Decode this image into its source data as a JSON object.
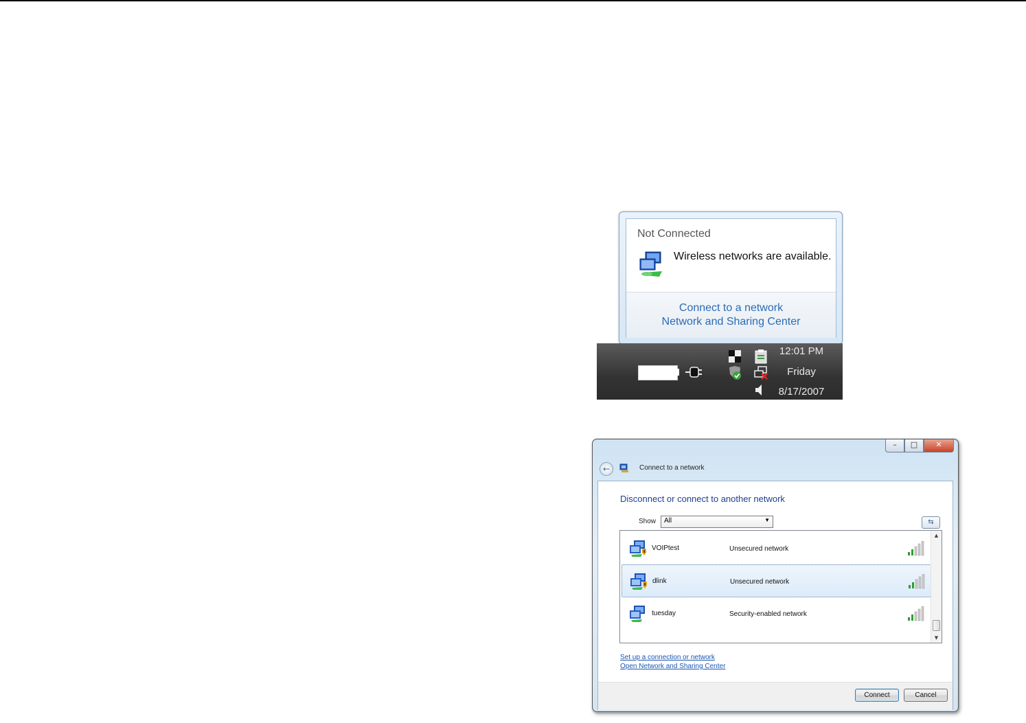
{
  "balloon": {
    "title": "Not Connected",
    "message": "Wireless networks are available.",
    "links": [
      "Connect to a network",
      "Network and Sharing Center"
    ]
  },
  "taskbar": {
    "time": "12:01 PM",
    "day": "Friday",
    "date": "8/17/2007",
    "icons": [
      "battery-icon",
      "power-plug-icon",
      "network-icon",
      "security-shield-icon",
      "clipboard-icon",
      "network-disconnected-icon",
      "speaker-icon"
    ]
  },
  "dialog": {
    "window_title": "Connect to a network",
    "heading": "Disconnect or connect to another network",
    "show_label": "Show",
    "show_value": "All",
    "networks": [
      {
        "name": "VOIPtest",
        "status": "Unsecured network",
        "signal_bars": 5
      },
      {
        "name": "dlink",
        "status": "Unsecured network",
        "signal_bars": 5,
        "selected": true
      },
      {
        "name": "tuesday",
        "status": "Security-enabled network",
        "signal_bars": 5
      }
    ],
    "links": [
      "Set up a connection or network",
      "Open Network and Sharing Center"
    ],
    "connect_label": "Connect",
    "cancel_label": "Cancel",
    "colors": {
      "heading": "#1e3f91",
      "link": "#1a55b5",
      "signal": "#2fa02f"
    }
  }
}
